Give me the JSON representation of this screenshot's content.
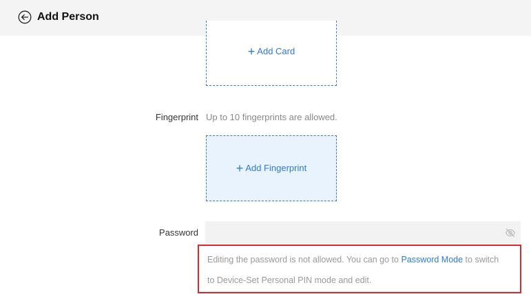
{
  "header": {
    "title": "Add Person"
  },
  "card": {
    "add_label": "Add Card"
  },
  "fingerprint": {
    "label": "Fingerprint",
    "hint": "Up to 10 fingerprints are allowed.",
    "add_label": "Add Fingerprint"
  },
  "password": {
    "label": "Password",
    "value": "",
    "notice_prefix": "Editing the password is not allowed. You can go to ",
    "notice_link": "Password Mode",
    "notice_suffix": " to switch",
    "notice_line2": "to Device-Set Personal PIN mode and edit."
  },
  "colors": {
    "accent": "#2b7ad6",
    "highlight_border": "#e0262b",
    "fingerprint_bg": "#e9f3fd"
  }
}
